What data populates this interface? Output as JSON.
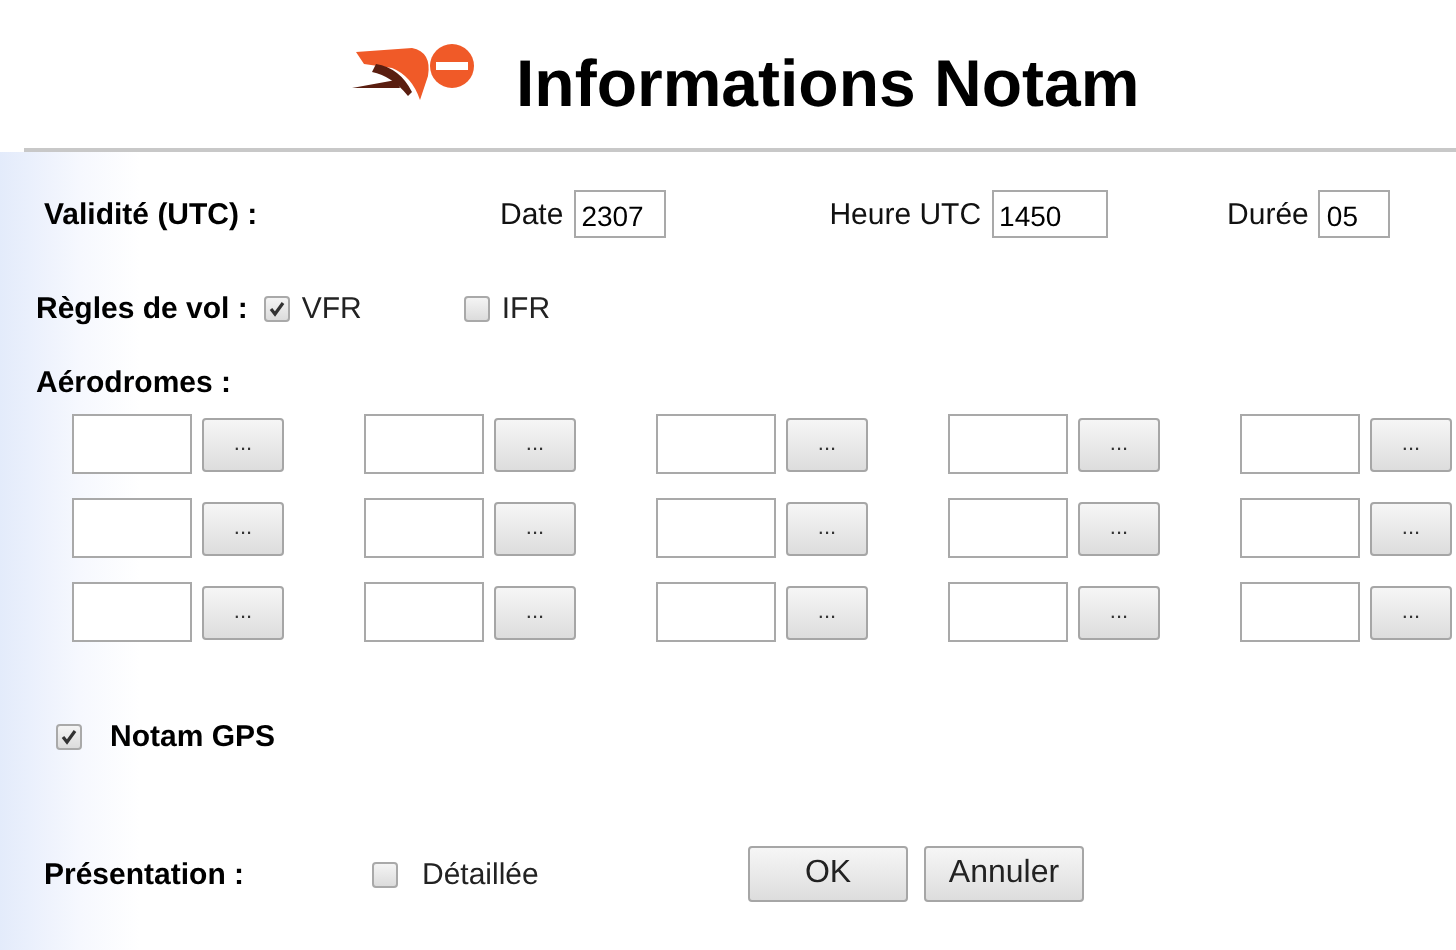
{
  "header": {
    "title": "Informations Notam"
  },
  "validity": {
    "label": "Validité (UTC) :",
    "fields": [
      {
        "label": "Date",
        "value": "2307"
      },
      {
        "label": "Heure UTC",
        "value": "1450"
      },
      {
        "label": "Durée",
        "value": "05"
      }
    ]
  },
  "flight_rules": {
    "label": "Règles de vol :",
    "options": [
      {
        "label": "VFR",
        "checked": true
      },
      {
        "label": "IFR",
        "checked": false
      }
    ]
  },
  "aerodromes": {
    "label": "Aérodromes :",
    "slots": [
      {
        "button": "..."
      },
      {
        "button": "..."
      },
      {
        "button": "..."
      },
      {
        "button": "..."
      },
      {
        "button": "..."
      },
      {
        "button": "..."
      },
      {
        "button": "..."
      },
      {
        "button": "..."
      },
      {
        "button": "..."
      },
      {
        "button": "..."
      },
      {
        "button": "..."
      },
      {
        "button": "..."
      },
      {
        "button": "..."
      },
      {
        "button": "..."
      },
      {
        "button": "..."
      }
    ]
  },
  "notam_gps": {
    "label": "Notam GPS",
    "checked": true
  },
  "presentation": {
    "label": "Présentation :",
    "option": {
      "label": "Détaillée",
      "checked": false
    },
    "buttons": [
      {
        "label": "OK"
      },
      {
        "label": "Annuler"
      }
    ]
  }
}
